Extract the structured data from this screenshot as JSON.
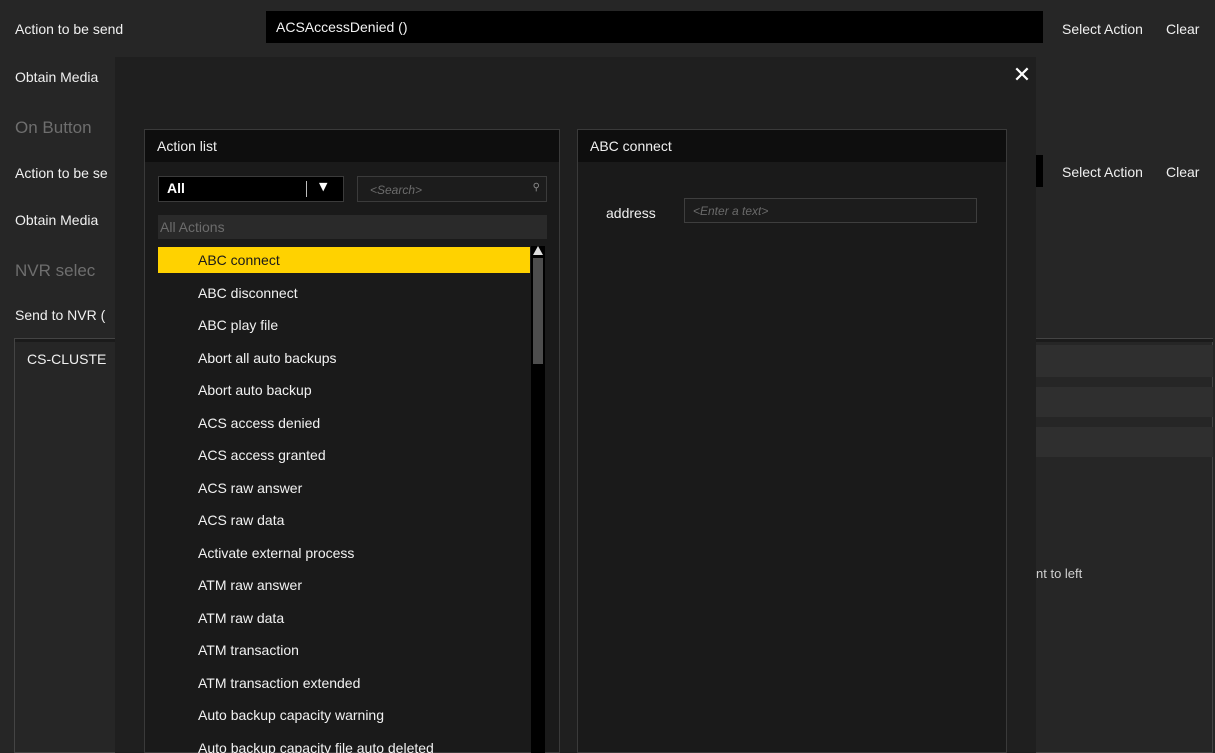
{
  "background": {
    "row1": {
      "label": "Action to be send",
      "value": "ACSAccessDenied ()",
      "select_action": "Select Action",
      "clear": "Clear"
    },
    "row2_label": "Obtain Media",
    "section_on_button": "On Button",
    "row3": {
      "label": "Action to be se",
      "select_action": "Select Action",
      "clear": "Clear"
    },
    "row4_label": "Obtain Media",
    "section_nvr": "NVR selec",
    "send_to_nvr": "Send to NVR (",
    "cluster_item": "CS-CLUSTE",
    "right_text": "nt to left"
  },
  "modal": {
    "close_glyph": "✕",
    "action_list_title": "Action list",
    "filter": {
      "value": "All",
      "caret": "▼"
    },
    "search": {
      "placeholder": "<Search>",
      "icon": "⚲"
    },
    "group": "All Actions",
    "items": [
      "ABC connect",
      "ABC disconnect",
      "ABC play file",
      "Abort all auto backups",
      "Abort auto backup",
      "ACS access denied",
      "ACS access granted",
      "ACS raw answer",
      "ACS raw data",
      "Activate external process",
      "ATM raw answer",
      "ATM raw data",
      "ATM transaction",
      "ATM transaction extended",
      "Auto backup capacity warning",
      "Auto backup capacity file auto deleted"
    ],
    "selected_index": 0,
    "details_title": "ABC connect",
    "param_label": "address",
    "param_placeholder": "<Enter a text>"
  },
  "colors": {
    "selection": "#ffd200",
    "background": "#262626",
    "modal": "#1f1f1f"
  }
}
